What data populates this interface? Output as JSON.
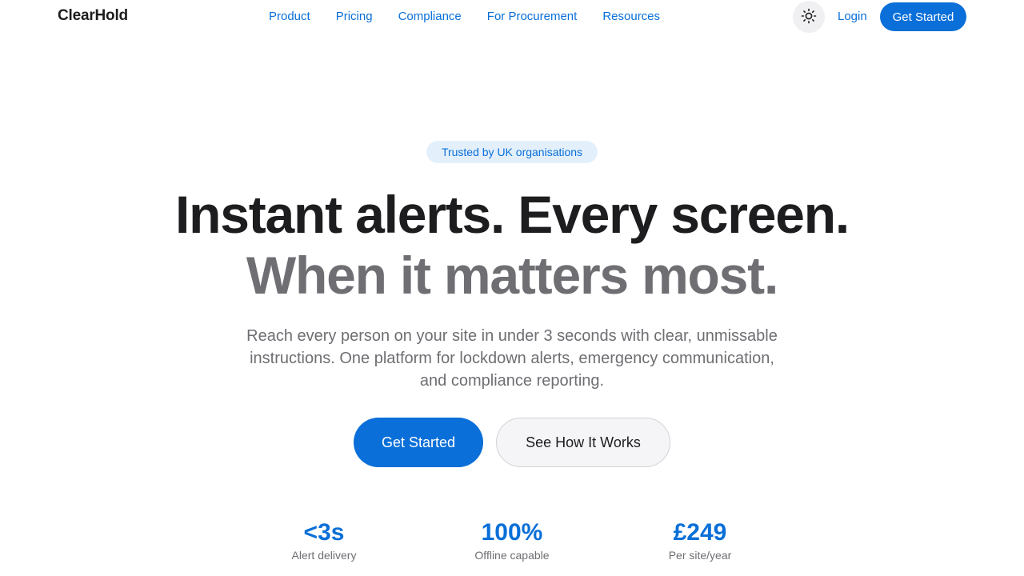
{
  "header": {
    "brand": "ClearHold",
    "nav": [
      "Product",
      "Pricing",
      "Compliance",
      "For Procurement",
      "Resources"
    ],
    "theme_toggle_icon": "sun-icon",
    "login": "Login",
    "cta": "Get Started"
  },
  "hero": {
    "badge": "Trusted by UK organisations",
    "headline_line1": "Instant alerts. Every screen.",
    "headline_line2": "When it matters most.",
    "description": "Reach every person on your site in under 3 seconds with clear, unmissable instructions. One platform for lockdown alerts, emergency communication, and compliance reporting.",
    "primary_cta": "Get Started",
    "secondary_cta": "See How It Works"
  },
  "stats": [
    {
      "value": "<3s",
      "label": "Alert delivery"
    },
    {
      "value": "100%",
      "label": "Offline capable"
    },
    {
      "value": "£249",
      "label": "Per site/year"
    }
  ],
  "colors": {
    "accent": "#0a6fd8",
    "text_primary": "#1d1d1f",
    "text_secondary": "#6e6e73",
    "badge_bg": "#e3f0fc"
  }
}
